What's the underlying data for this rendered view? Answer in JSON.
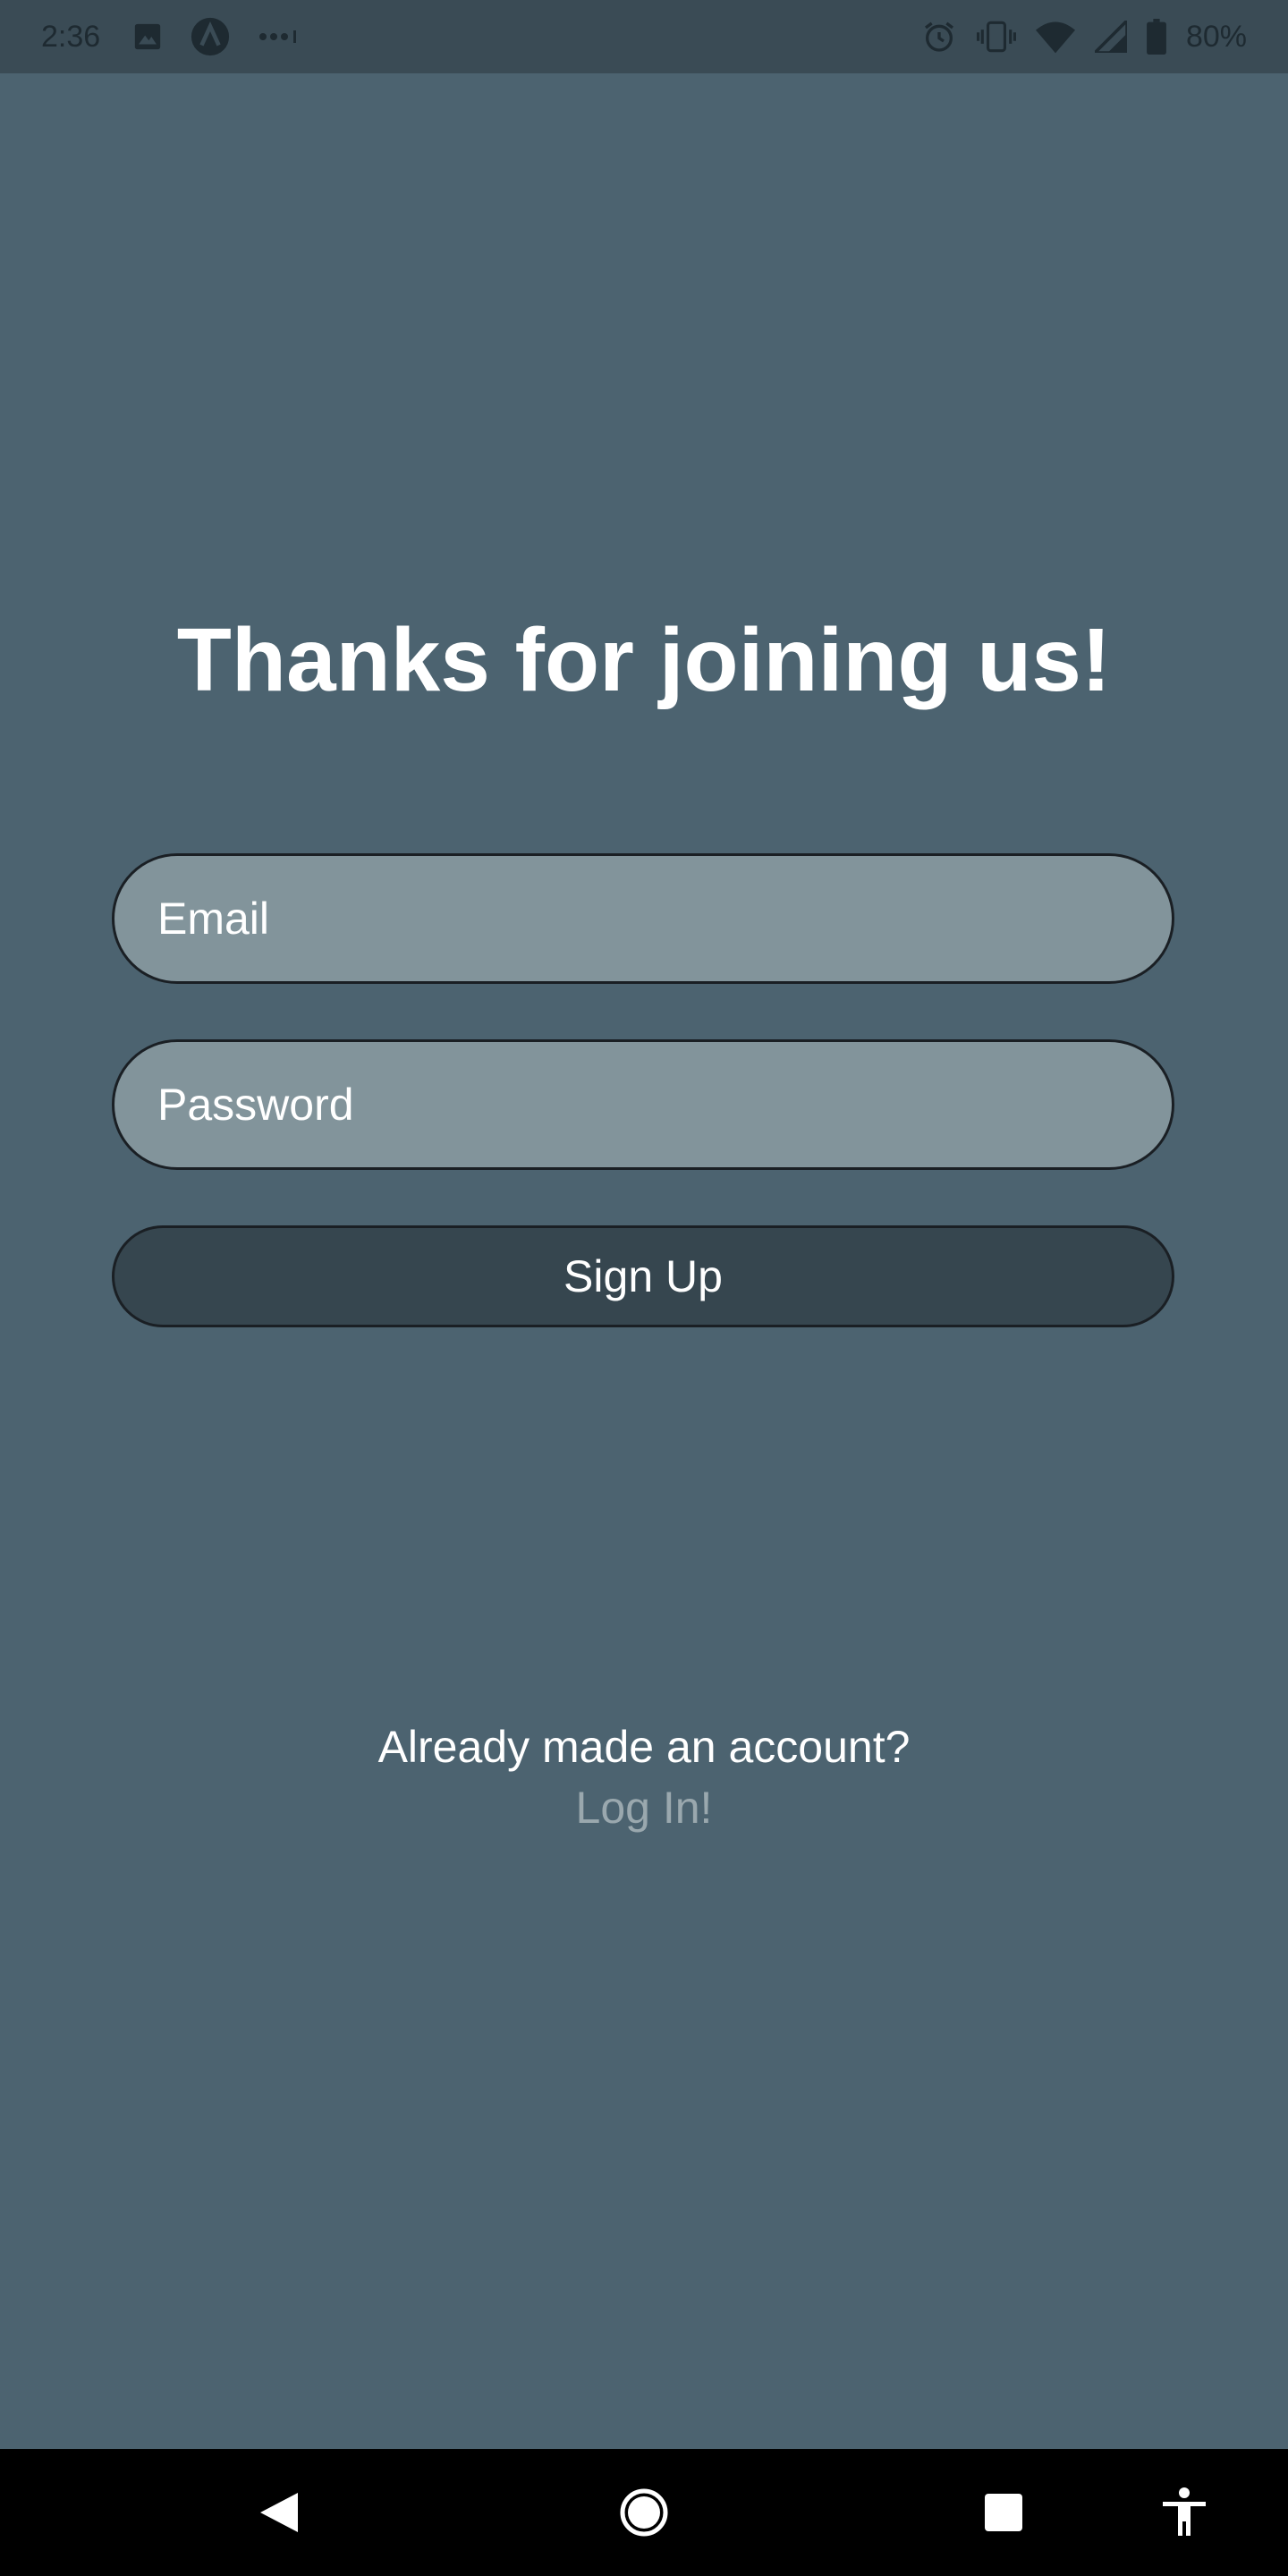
{
  "status_bar": {
    "time": "2:36",
    "battery_percent": "80%",
    "left_icons": [
      "image-icon",
      "app-a-icon",
      "more-dots-icon"
    ],
    "right_icons": [
      "alarm-icon",
      "vibrate-icon",
      "wifi-icon",
      "signal-icon",
      "battery-icon"
    ]
  },
  "main": {
    "title": "Thanks for joining us!",
    "email": {
      "placeholder": "Email",
      "value": ""
    },
    "password": {
      "placeholder": "Password",
      "value": ""
    },
    "signup_label": "Sign Up",
    "already_text": "Already made an account?",
    "login_label": "Log In!"
  },
  "nav_bar": {
    "buttons": [
      "back-icon",
      "home-icon",
      "recents-icon",
      "accessibility-icon"
    ]
  },
  "colors": {
    "background": "#4c6370",
    "input_fill": "#82949b",
    "button_fill": "#36464f",
    "link": "#9aa8ae"
  }
}
